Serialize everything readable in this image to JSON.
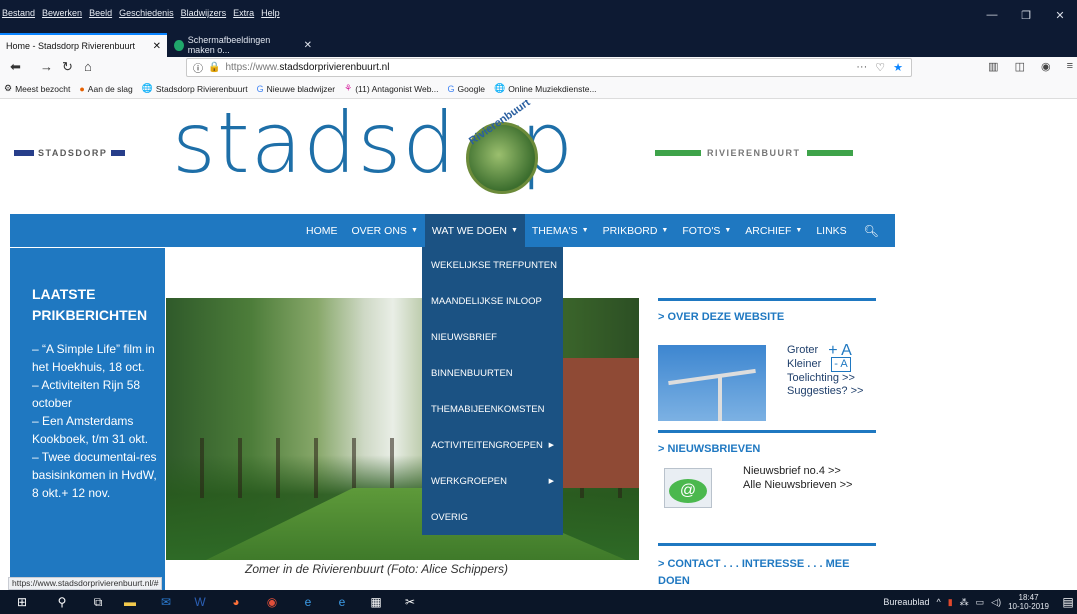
{
  "browser": {
    "menus": [
      "Bestand",
      "Bewerken",
      "Beeld",
      "Geschiedenis",
      "Bladwijzers",
      "Extra",
      "Help"
    ],
    "tabs": [
      {
        "title": "Home - Stadsdorp Rivierenbuurt",
        "close": "✕"
      },
      {
        "title": "Schermafbeeldingen maken o...",
        "close": "✕"
      }
    ],
    "url_prefix": "https://www.",
    "url_domain": "stadsdorprivierenbuurt.nl",
    "url_more": "···",
    "bookmarks": [
      "Meest bezocht",
      "Aan de slag",
      "Stadsdorp Rivierenbuurt",
      "Nieuwe bladwijzer",
      "(11) Antagonist Web...",
      "Google",
      "Online Muziekdienste..."
    ],
    "status_url": "https://www.stadsdorprivierenbuurt.nl/#"
  },
  "header": {
    "left_brand": "STADSDORP",
    "logo_text": "stadsd  rp",
    "badge_text": "Rivierenbuurt",
    "right_brand": "RIVIERENBUURT"
  },
  "nav": {
    "items": [
      {
        "label": "HOME",
        "caret": ""
      },
      {
        "label": "OVER ONS",
        "caret": "▼"
      },
      {
        "label": "WAT WE DOEN",
        "caret": "▼"
      },
      {
        "label": "THEMA'S",
        "caret": "▼"
      },
      {
        "label": "PRIKBORD",
        "caret": "▼"
      },
      {
        "label": "FOTO'S",
        "caret": "▼"
      },
      {
        "label": "ARCHIEF",
        "caret": "▼"
      },
      {
        "label": "LINKS",
        "caret": ""
      }
    ],
    "search_icon": "search-icon"
  },
  "dropdown": {
    "items": [
      {
        "label": "WEKELIJKSE TREFPUNTEN",
        "sub": ""
      },
      {
        "label": "MAANDELIJKSE INLOOP",
        "sub": ""
      },
      {
        "label": "NIEUWSBRIEF",
        "sub": ""
      },
      {
        "label": "BINNENBUURTEN",
        "sub": ""
      },
      {
        "label": "THEMABIJEENKOMSTEN",
        "sub": ""
      },
      {
        "label": "ACTIVITEITENGROEPEN",
        "sub": "▶"
      },
      {
        "label": "WERKGROEPEN",
        "sub": "▶"
      },
      {
        "label": "OVERIG",
        "sub": ""
      }
    ]
  },
  "sidebar": {
    "heading": "LAATSTE PRIKBERICHTEN",
    "items": [
      "– “A Simple Life” film in het Hoekhuis, 18 oct.",
      "– Activiteiten Rijn 58 october",
      "– Een Amsterdams Kookboek, t/m 31 okt.",
      "– Twee documentai-res basisinkomen in HvdW, 8 okt.+ 12 nov."
    ]
  },
  "main": {
    "caption": "Zomer in de Rivierenbuurt (Foto: Alice Schippers)"
  },
  "right": {
    "over_heading": "> OVER DEZE WEBSITE",
    "groter": "Groter",
    "plus": "+ A",
    "kleiner": "Kleiner",
    "minus": "- A",
    "toelichting": "Toelichting >>",
    "suggesties": "Suggesties? >>",
    "nieuws_heading": "> NIEUWSBRIEVEN",
    "nieuwsbrief": "Nieuwsbrief no.4 >>",
    "alle": "Alle Nieuwsbrieven >>",
    "contact_heading": "> CONTACT . . . INTERESSE . . . MEE DOEN"
  },
  "taskbar": {
    "desktop_label": "Bureaublad",
    "time": "18:47",
    "date": "10-10-2019"
  }
}
